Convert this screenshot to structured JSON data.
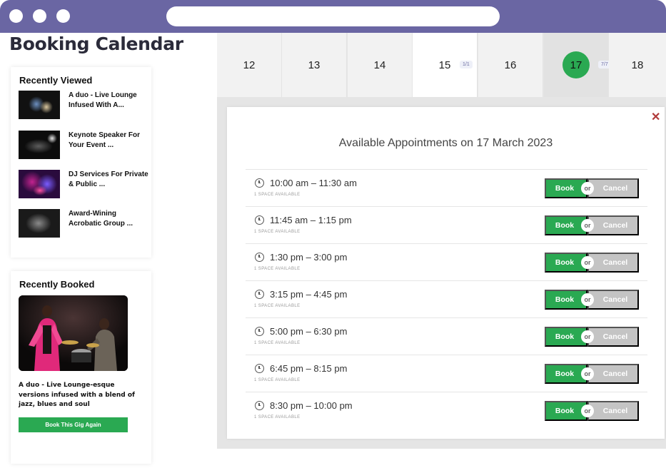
{
  "page": {
    "title": "Booking Calendar"
  },
  "colors": {
    "chrome": "#6a66a3",
    "accent_green": "#2aa952",
    "cancel_grey": "#c4c4c4",
    "close_red": "#b03a3a"
  },
  "recently_viewed": {
    "heading": "Recently Viewed",
    "items": [
      {
        "title": "A duo - Live Lounge Infused With A..."
      },
      {
        "title": "Keynote Speaker For Your Event ..."
      },
      {
        "title": "DJ Services For Private & Public ..."
      },
      {
        "title": "Award-Wining Acrobatic Group ..."
      }
    ]
  },
  "recently_booked": {
    "heading": "Recently Booked",
    "description": "A duo - Live Lounge-esque versions infused with a blend of jazz, blues and soul",
    "button_label": "Book This Gig Again"
  },
  "calendar": {
    "days": [
      {
        "label": "12"
      },
      {
        "label": "13"
      },
      {
        "label": "14"
      },
      {
        "label": "15",
        "badge": "1/1"
      },
      {
        "label": "16"
      },
      {
        "label": "17",
        "badge": "7/7",
        "selected": true
      },
      {
        "label": "18"
      }
    ]
  },
  "appointments": {
    "title": "Available Appointments on 17 March 2023",
    "close_icon": "close-icon",
    "book_label": "Book",
    "or_label": "or",
    "cancel_label": "Cancel",
    "slots": [
      {
        "time": "10:00 am – 11:30 am",
        "space": "1 SPACE AVAILABLE"
      },
      {
        "time": "11:45 am – 1:15 pm",
        "space": "1 SPACE AVAILABLE"
      },
      {
        "time": "1:30 pm – 3:00 pm",
        "space": "1 SPACE AVAILABLE"
      },
      {
        "time": "3:15 pm – 4:45 pm",
        "space": "1 SPACE AVAILABLE"
      },
      {
        "time": "5:00 pm – 6:30 pm",
        "space": "1 SPACE AVAILABLE"
      },
      {
        "time": "6:45 pm – 8:15 pm",
        "space": "1 SPACE AVAILABLE"
      },
      {
        "time": "8:30 pm – 10:00 pm",
        "space": "1 SPACE AVAILABLE"
      }
    ]
  }
}
